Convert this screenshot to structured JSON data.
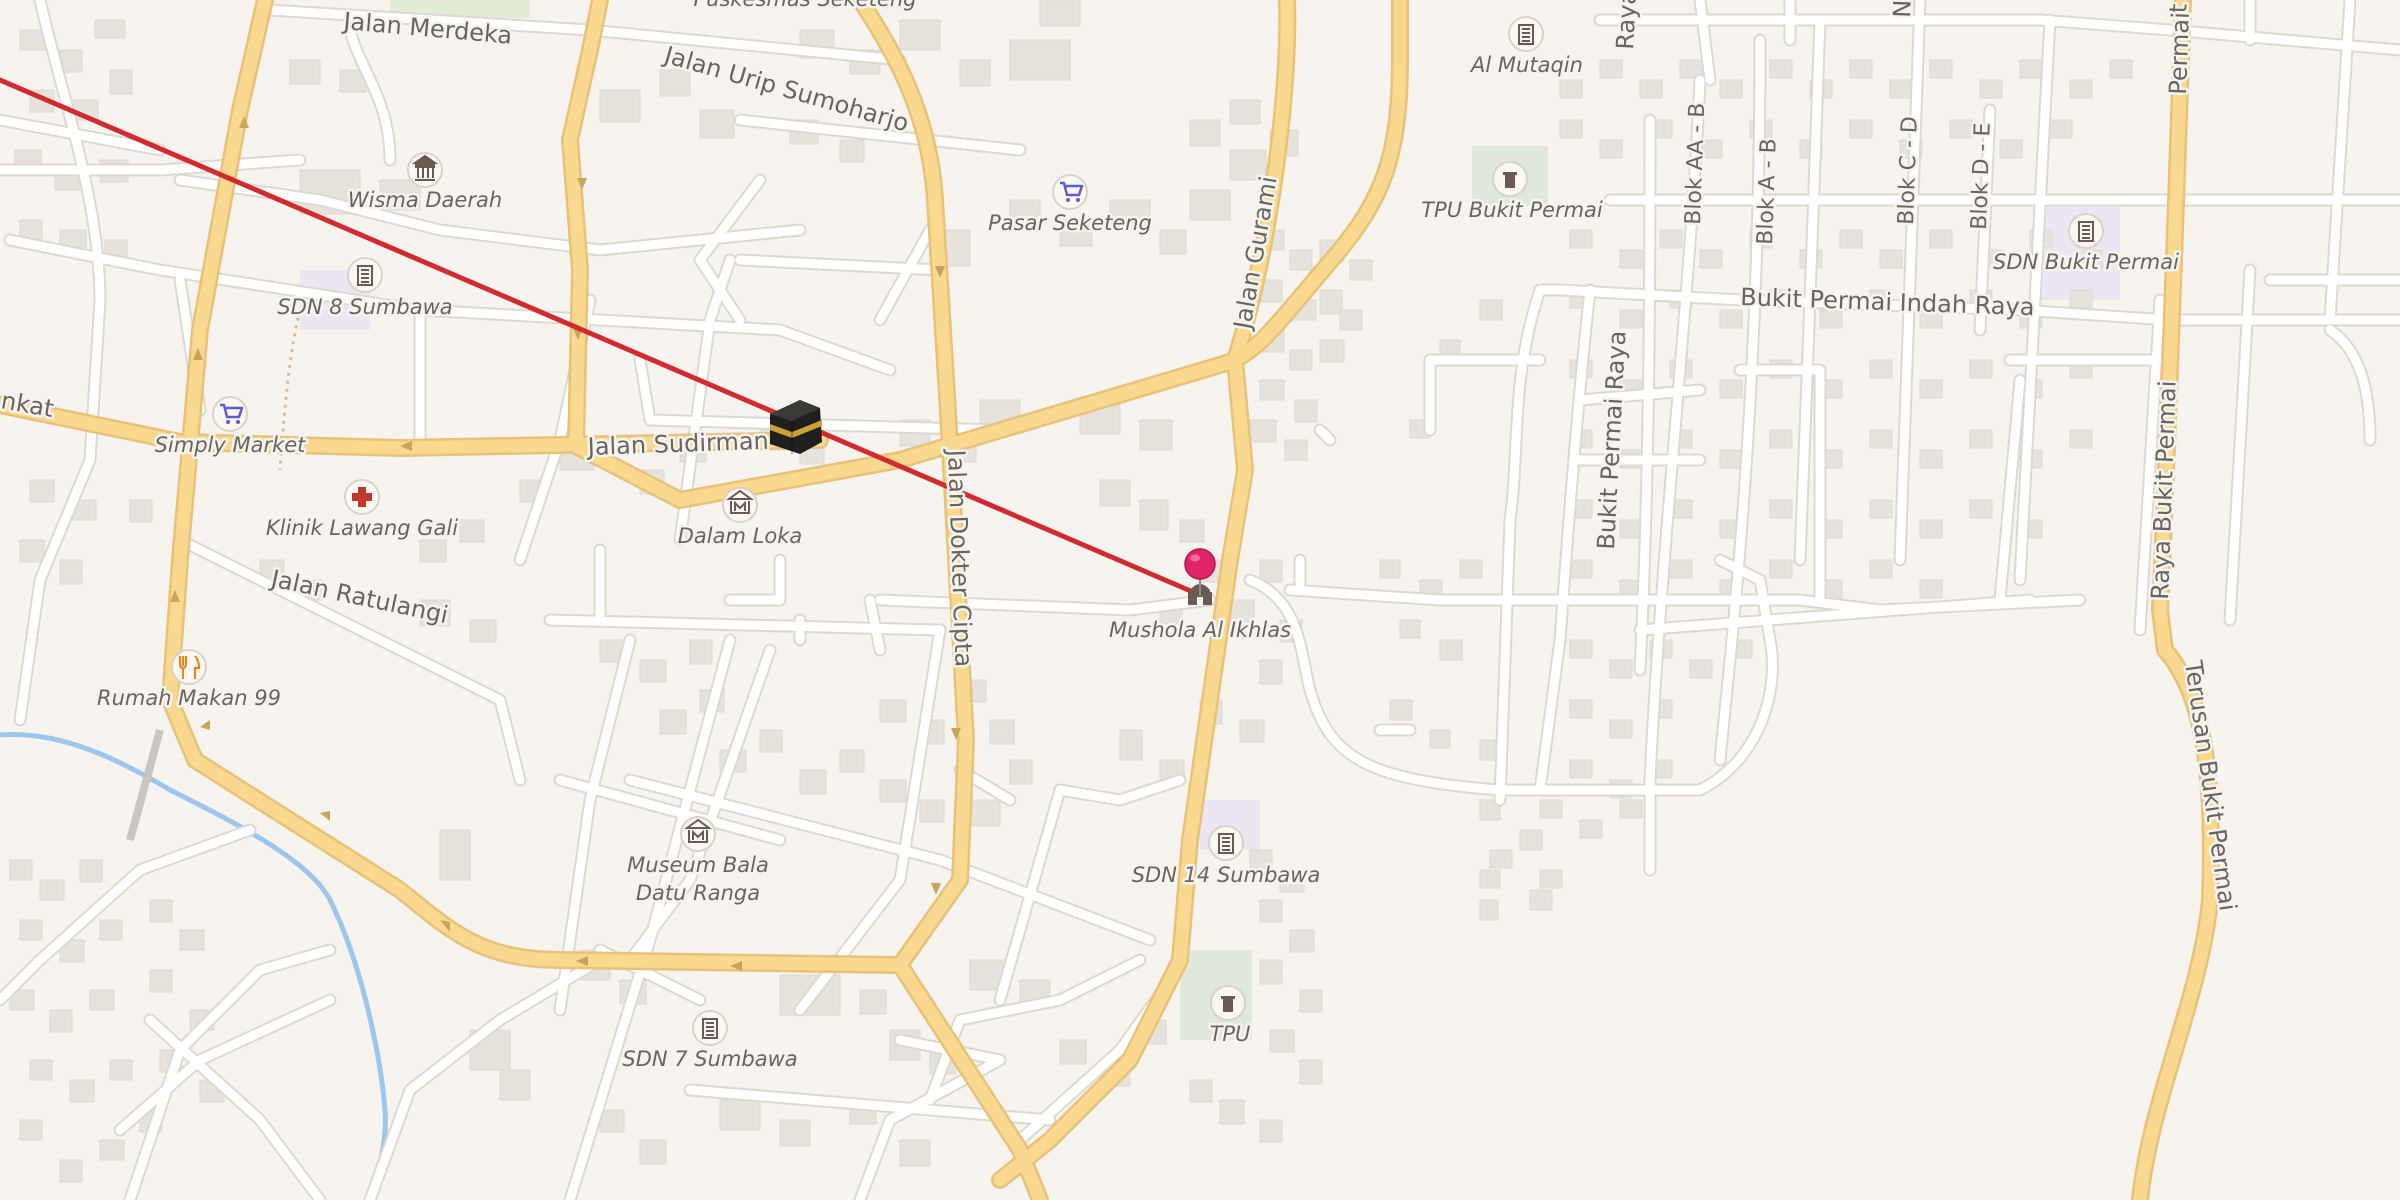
{
  "map": {
    "roads": {
      "jalan_merdeka": "Jalan Merdeka",
      "jalan_urip_sumoharjo": "Jalan Urip Sumoharjo",
      "jalan_sudirman": "Jalan Sudirman",
      "jalan_ratulangi": "Jalan Ratulangi",
      "jalan_dokter_cipta": "Jalan Dokter Cipta",
      "jalan_gurami": "Jalan Gurami",
      "bukit_permai_indah_raya": "Bukit Permai Indah Raya",
      "bukit_permai_raya": "Bukit Permai Raya",
      "raya_bukit_permai": "Raya Bukit Permai",
      "terusan_bukit_permai": "Terusan Bukit Permai",
      "blok_aa_b": "Blok AA - B",
      "blok_a_b": "Blok A - B",
      "blok_c_d": "Blok C - D",
      "blok_d_e": "Blok D - E",
      "jalan_partial_left": "nkat",
      "raya_partial_top": "Raya"
    },
    "pois": {
      "puskesmas": "Puskesmas Seketeng",
      "wisma_daerah": "Wisma Daerah",
      "sdn8": "SDN 8 Sumbawa",
      "simply_market": "Simply Market",
      "klinik": "Klinik Lawang Gali",
      "dalam_loka": "Dalam Loka",
      "rumah_makan": "Rumah Makan 99",
      "museum_line1": "Museum Bala",
      "museum_line2": "Datu Ranga",
      "sdn7": "SDN 7 Sumbawa",
      "pasar": "Pasar Seketeng",
      "mushola": "Mushola Al Ikhlas",
      "sdn14": "SDN 14 Sumbawa",
      "tpu": "TPU",
      "al_mutaqin": "Al Mutaqin",
      "tpu_bukit_permai": "TPU Bukit Permai",
      "sdn_bukit_permai": "SDN Bukit Permai"
    },
    "colors": {
      "background": "#f7f4ef",
      "main_road": "#f8d98f",
      "main_road_casing": "#e8c27a",
      "minor_road": "#ffffff",
      "minor_road_casing": "#dcd8d2",
      "river": "#9cc6ec",
      "building": "#e6e2dc",
      "qibla_line": "#d12a2f",
      "pin": "#e0246a",
      "shopping_icon": "#5a5bd6",
      "medical_icon": "#c0392b",
      "food_icon": "#e08a1e",
      "civic_icon": "#6b5a52"
    },
    "icons": {
      "kaaba": "kaaba-icon",
      "pin": "location-pin-icon",
      "school": "school-icon",
      "shop": "shopping-cart-icon",
      "clinic": "medical-cross-icon",
      "food": "fork-knife-icon",
      "museum": "museum-icon",
      "cemetery": "cemetery-icon",
      "mosque": "mosque-icon"
    }
  }
}
